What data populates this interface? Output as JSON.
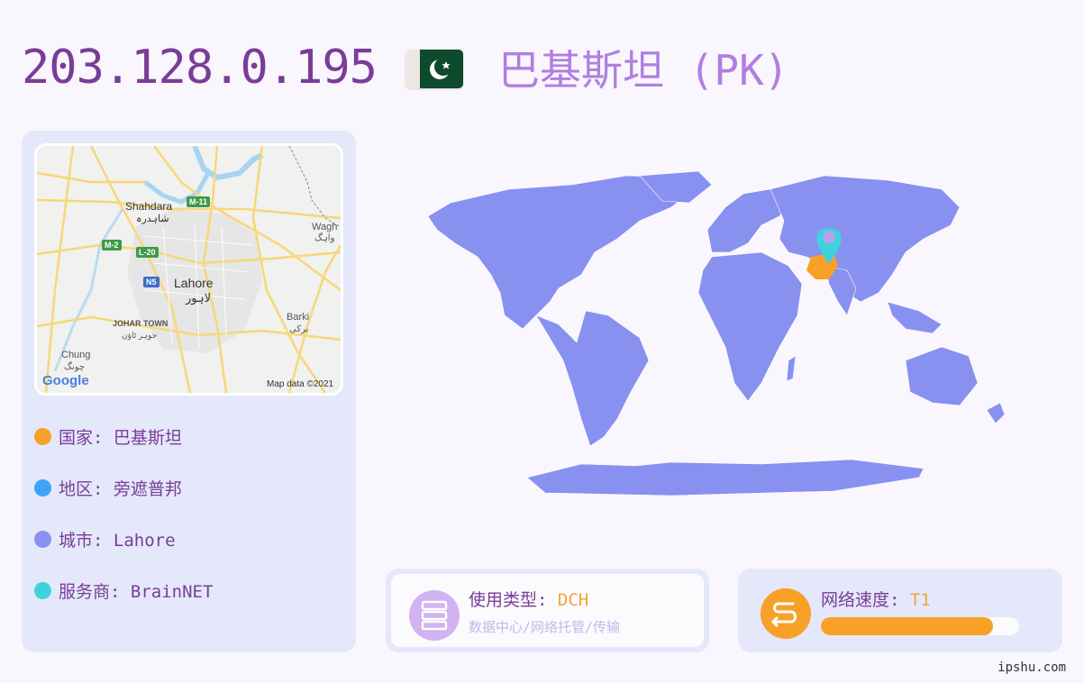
{
  "header": {
    "ip": "203.128.0.195",
    "country_title": "巴基斯坦 (PK)"
  },
  "flag": {
    "name": "pakistan-flag",
    "colors": [
      "#0e4a2c",
      "#ece8e4"
    ]
  },
  "map": {
    "labels": {
      "shahdara_en": "Shahdara",
      "shahdara_ur": "شاہدرہ",
      "lahore_en": "Lahore",
      "lahore_ur": "لاہور",
      "wagha_en": "Wagh",
      "wagha_ur": "واہگ",
      "barki_en": "Barki",
      "barki_ur": "برکی",
      "johar_en": "JOHAR TOWN",
      "johar_ur": "جوہر ٹاؤن",
      "chung_en": "Chung",
      "chung_ur": "چونگ"
    },
    "roads": {
      "m11": "M-11",
      "m2": "M-2",
      "l20": "L-20",
      "n5": "N5"
    },
    "attribution": "Map data ©2021",
    "logo": "Google"
  },
  "info": [
    {
      "label": "国家:",
      "value": "巴基斯坦",
      "color": "#f8a028"
    },
    {
      "label": "地区:",
      "value": "旁遮普邦",
      "color": "#3ea3f5"
    },
    {
      "label": "城市:",
      "value": "Lahore",
      "color": "#8891f0"
    },
    {
      "label": "服务商:",
      "value": "BrainNET",
      "color": "#3ed3dc"
    }
  ],
  "usage": {
    "label": "使用类型:",
    "value": "DCH",
    "description": "数据中心/网络托管/传输",
    "icon": "server-icon"
  },
  "speed": {
    "label": "网络速度:",
    "value": "T1",
    "level": 0.87,
    "icon": "speed-icon"
  },
  "colors": {
    "accent_purple": "#7a3d97",
    "light_purple": "#b07fe0",
    "orange": "#f8a028",
    "map_land": "#8891f0",
    "pin": "#3ed3dc"
  },
  "watermark": "ipshu.com"
}
